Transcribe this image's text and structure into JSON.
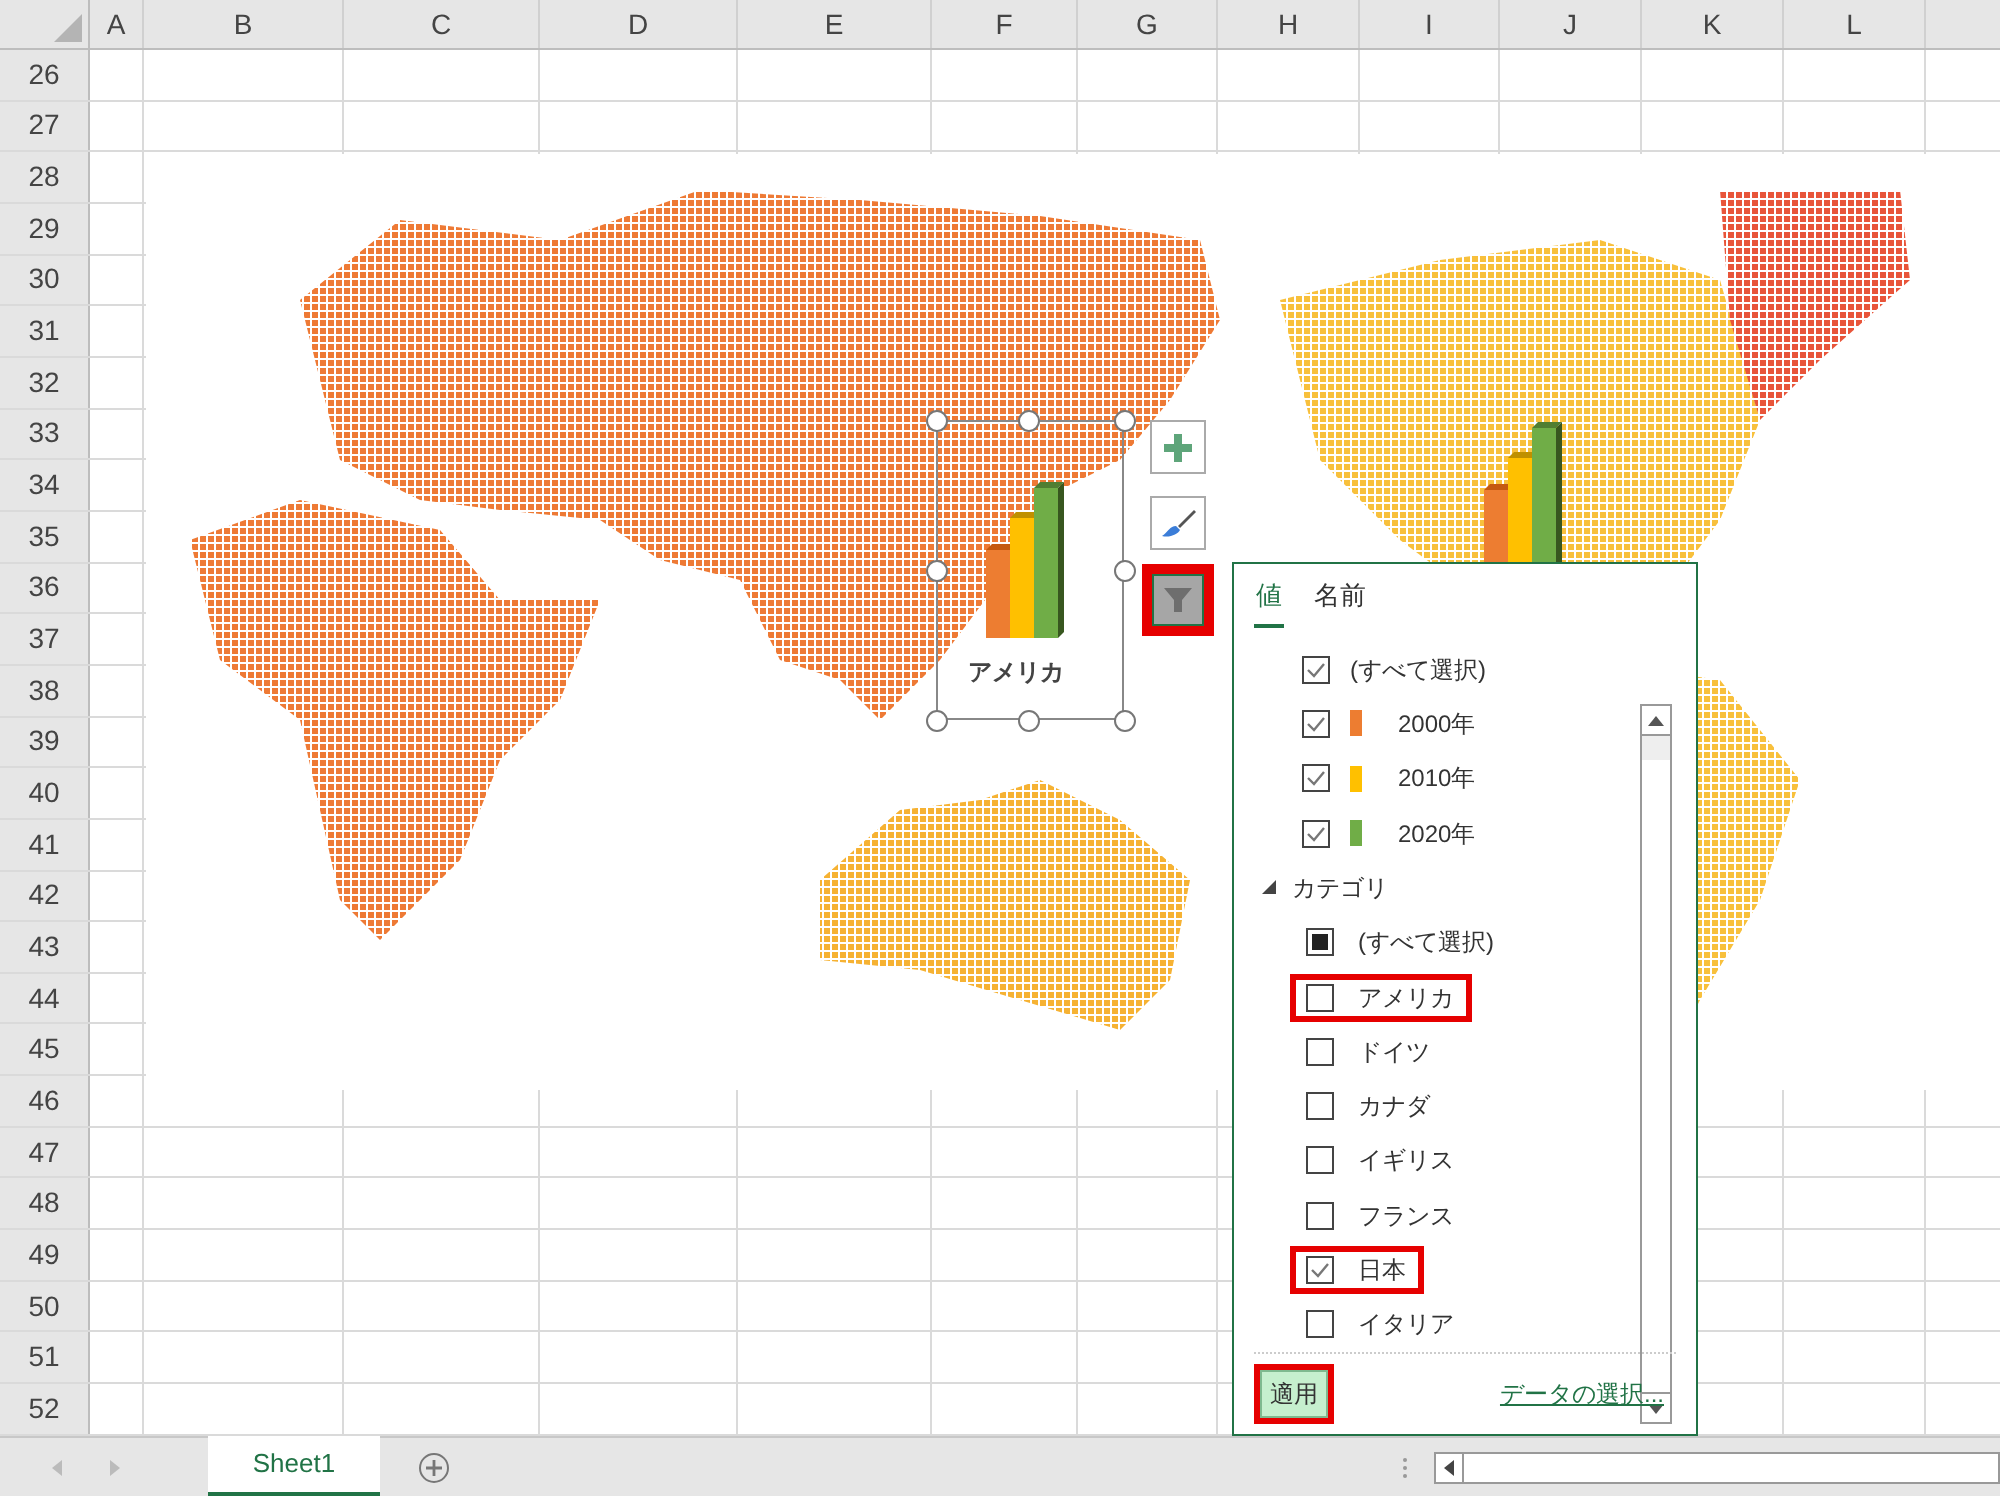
{
  "columns": [
    "A",
    "B",
    "C",
    "D",
    "E",
    "F",
    "G",
    "H",
    "I",
    "J",
    "K",
    "L"
  ],
  "rows": [
    "26",
    "27",
    "28",
    "29",
    "30",
    "31",
    "32",
    "33",
    "34",
    "35",
    "36",
    "37",
    "38",
    "39",
    "40",
    "41",
    "42",
    "43",
    "44",
    "45",
    "46",
    "47",
    "48",
    "49",
    "50",
    "51",
    "52"
  ],
  "chart": {
    "selected_label": "アメリカ",
    "filter_highlighted": true
  },
  "filter_panel": {
    "tabs": [
      {
        "label": "値",
        "selected": true
      },
      {
        "label": "名前",
        "selected": false
      }
    ],
    "series": [
      {
        "label": "(すべて選択)",
        "checked": true
      },
      {
        "label": "2000年",
        "checked": true,
        "color": "#ed7d31"
      },
      {
        "label": "2010年",
        "checked": true,
        "color": "#ffc000"
      },
      {
        "label": "2020年",
        "checked": true,
        "color": "#70ad47"
      }
    ],
    "category_group": {
      "label": "カテゴリ",
      "expanded": true
    },
    "categories": [
      {
        "label": "(すべて選択)",
        "checked": false,
        "partial": true,
        "highlighted": false
      },
      {
        "label": "アメリカ",
        "checked": false,
        "partial": false,
        "highlighted": true
      },
      {
        "label": "ドイツ",
        "checked": false,
        "partial": false,
        "highlighted": false
      },
      {
        "label": "カナダ",
        "checked": false,
        "partial": false,
        "highlighted": false
      },
      {
        "label": "イギリス",
        "checked": false,
        "partial": false,
        "highlighted": false
      },
      {
        "label": "フランス",
        "checked": false,
        "partial": false,
        "highlighted": false
      },
      {
        "label": "日本",
        "checked": true,
        "partial": false,
        "highlighted": true
      },
      {
        "label": "イタリア",
        "checked": false,
        "partial": false,
        "highlighted": false
      }
    ],
    "apply": {
      "label": "適用",
      "highlighted": true
    },
    "link": "データの選択..."
  },
  "sheet_tabs": [
    {
      "label": "Sheet1",
      "selected": true
    }
  ]
}
